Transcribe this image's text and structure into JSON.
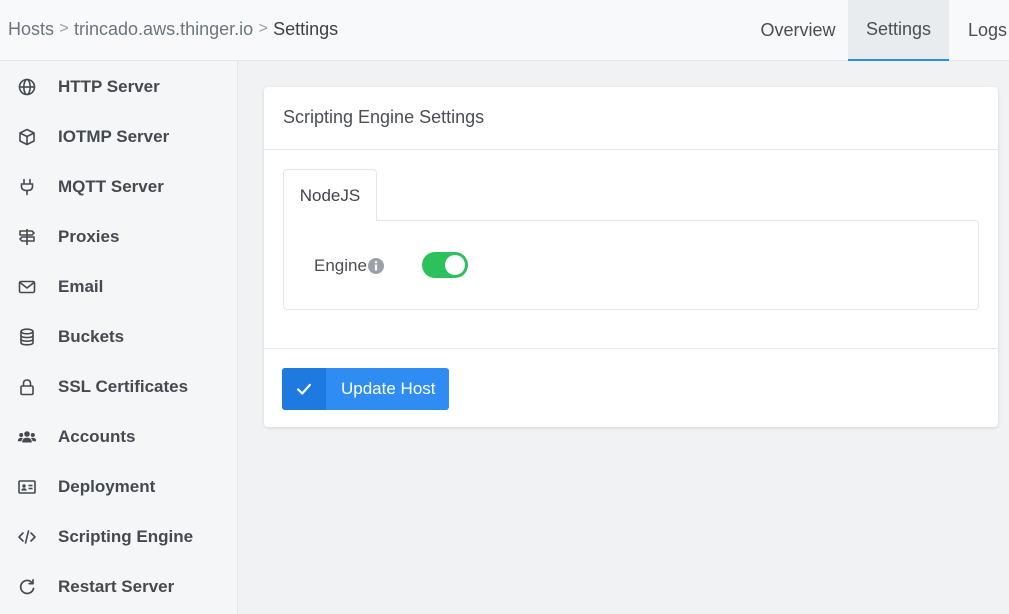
{
  "breadcrumb": {
    "items": [
      "Hosts",
      "trincado.aws.thinger.io",
      "Settings"
    ],
    "separator": ">"
  },
  "tabs": [
    {
      "label": "Overview",
      "active": false
    },
    {
      "label": "Settings",
      "active": true
    },
    {
      "label": "Logs",
      "active": false
    }
  ],
  "sidebar": {
    "items": [
      {
        "label": "HTTP Server",
        "icon": "globe-icon"
      },
      {
        "label": "IOTMP Server",
        "icon": "cube-icon"
      },
      {
        "label": "MQTT Server",
        "icon": "plug-icon"
      },
      {
        "label": "Proxies",
        "icon": "signpost-icon"
      },
      {
        "label": "Email",
        "icon": "envelope-icon"
      },
      {
        "label": "Buckets",
        "icon": "database-icon"
      },
      {
        "label": "SSL Certificates",
        "icon": "lock-icon"
      },
      {
        "label": "Accounts",
        "icon": "users-icon"
      },
      {
        "label": "Deployment",
        "icon": "id-card-icon"
      },
      {
        "label": "Scripting Engine",
        "icon": "code-icon"
      },
      {
        "label": "Restart Server",
        "icon": "redo-icon"
      }
    ]
  },
  "card": {
    "title": "Scripting Engine Settings",
    "inner_tab": "NodeJS",
    "engine_label": "Engine",
    "engine_enabled": true,
    "update_button": "Update Host"
  },
  "colors": {
    "accent": "#2e8cf3",
    "toggle_on": "#2cc15a"
  }
}
